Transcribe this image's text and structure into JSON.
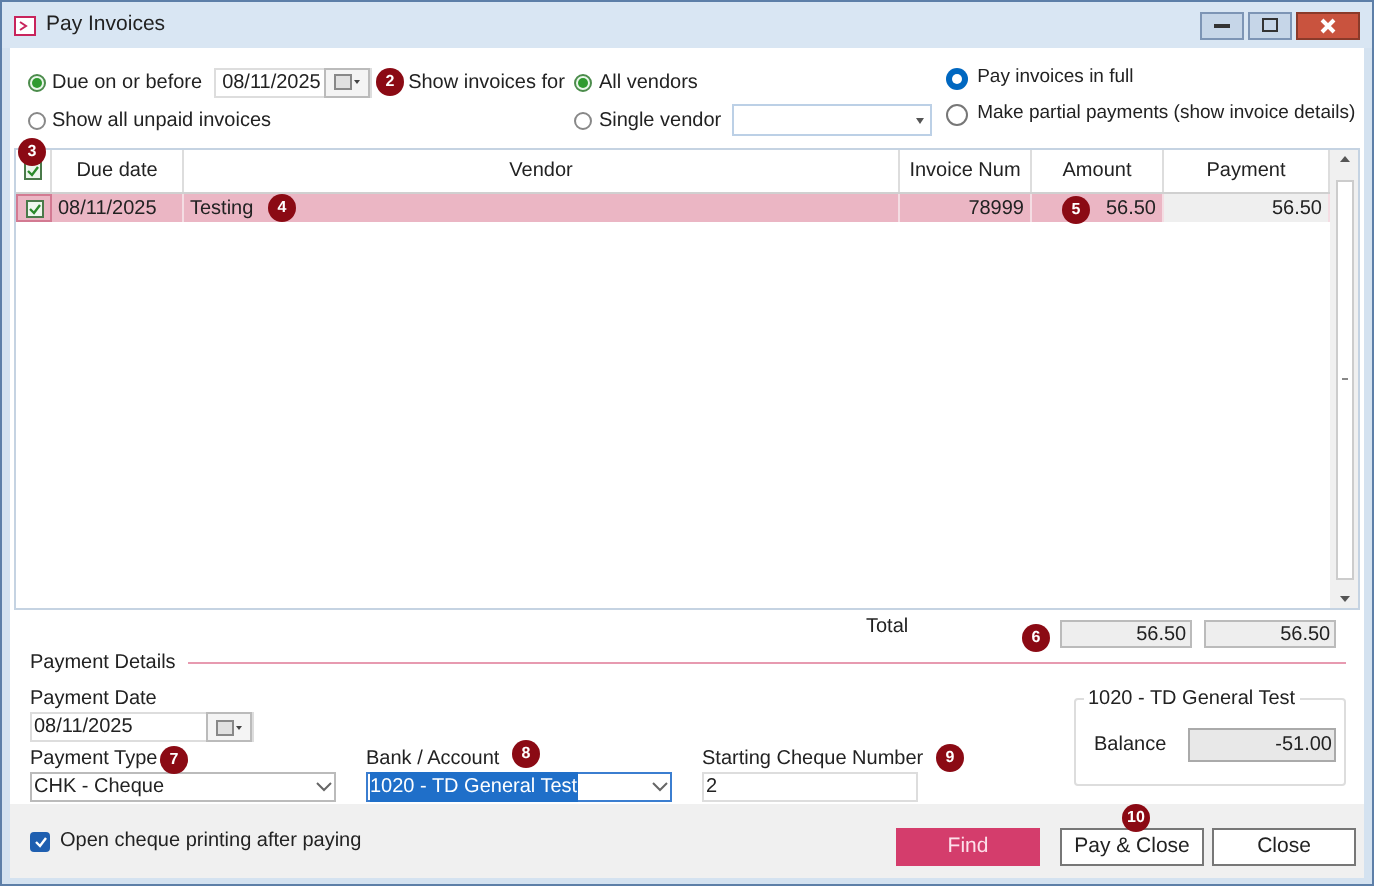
{
  "window": {
    "title": "Pay Invoices"
  },
  "filters": {
    "due_options": [
      {
        "label": "Due on or before",
        "selected": true
      },
      {
        "label": "Show all unpaid invoices",
        "selected": false
      }
    ],
    "due_date": "08/11/2025",
    "show_for_label": "Show invoices for",
    "vendor_options": [
      {
        "label": "All vendors",
        "selected": true
      },
      {
        "label": "Single vendor",
        "selected": false
      }
    ],
    "payment_mode": [
      {
        "label": "Pay invoices in full",
        "selected": true
      },
      {
        "label": "Make partial payments (show invoice details)",
        "selected": false
      }
    ]
  },
  "table": {
    "select_all_checked": true,
    "columns": [
      "Due date",
      "Vendor",
      "Invoice Num",
      "Amount",
      "Payment"
    ],
    "rows": [
      {
        "checked": true,
        "selected": true,
        "cells": [
          "08/11/2025",
          "Testing",
          "78999",
          "56.50",
          "56.50"
        ]
      }
    ]
  },
  "totals": {
    "label": "Total",
    "amount": "56.50",
    "payment": "56.50"
  },
  "payment_details": {
    "title": "Payment Details",
    "date_label": "Payment Date",
    "date": "08/11/2025",
    "type_label": "Payment Type",
    "type": "CHK - Cheque",
    "account_label": "Bank / Account",
    "account": "1020 - TD General Test",
    "cheque_label": "Starting Cheque Number",
    "cheque": "2",
    "balance_group": "1020 - TD General Test",
    "balance_label": "Balance",
    "balance": "-51.00"
  },
  "footer": {
    "open_printing": {
      "label": "Open cheque printing after paying",
      "checked": true
    },
    "buttons": [
      {
        "label": "Find",
        "kind": "primary"
      },
      {
        "label": "Pay & Close",
        "kind": "default"
      },
      {
        "label": "Close",
        "kind": "default"
      }
    ]
  },
  "callouts": [
    "2",
    "3",
    "4",
    "5",
    "6",
    "7",
    "8",
    "9",
    "10"
  ]
}
